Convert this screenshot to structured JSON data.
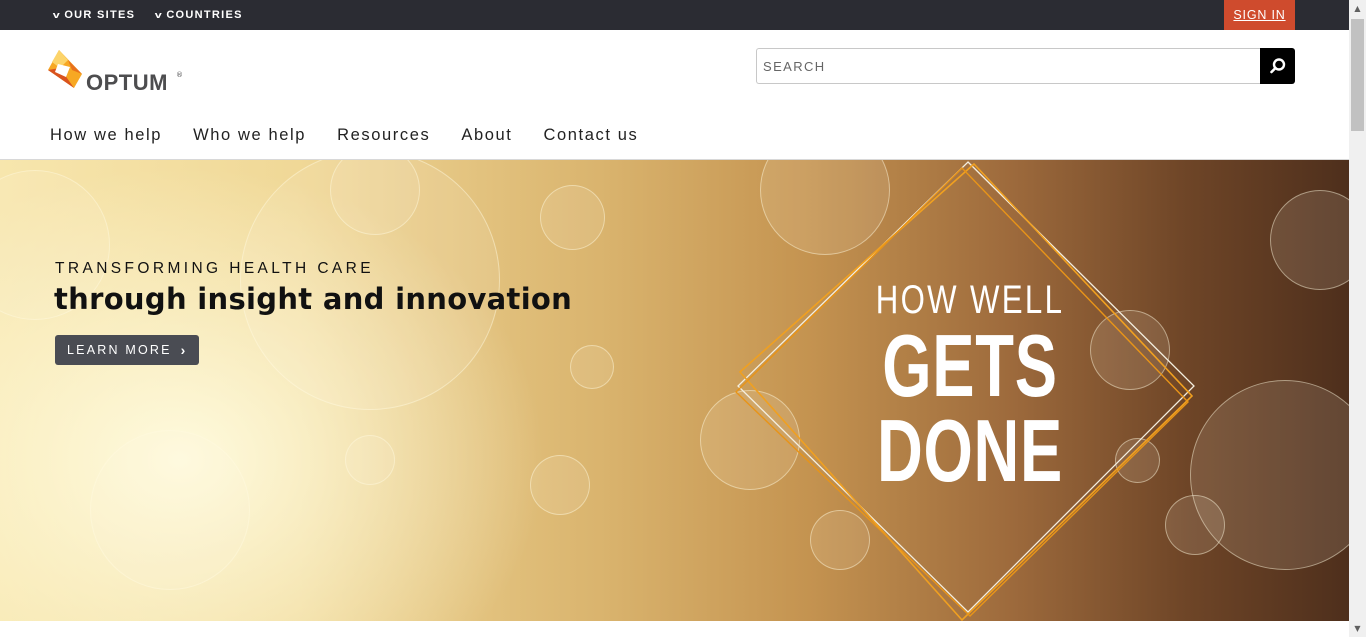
{
  "topbar": {
    "our_sites": "OUR SITES",
    "countries": "COUNTRIES",
    "sign_in": "SIGN IN"
  },
  "header": {
    "logo_text": "OPTUM",
    "logo_registered": "®",
    "search_placeholder": "SEARCH"
  },
  "nav": {
    "items": [
      "How we help",
      "Who we help",
      "Resources",
      "About",
      "Contact us"
    ]
  },
  "hero": {
    "kicker": "TRANSFORMING HEALTH CARE",
    "title": "through insight and innovation",
    "cta_label": "LEARN MORE",
    "tagline_line1": "HOW WELL",
    "tagline_line2": "GETS",
    "tagline_line3": "DONE"
  },
  "colors": {
    "topbar_bg": "#2b2c33",
    "sign_in_bg": "#cf4b2d",
    "logo_orange": "#f28c1b",
    "cta_bg": "#4a4c53",
    "diamond_orange": "#f0a020"
  },
  "icons": {
    "search_button": "search-icon",
    "dropdown": "chevron-down-icon",
    "cta": "chevron-right-icon"
  }
}
